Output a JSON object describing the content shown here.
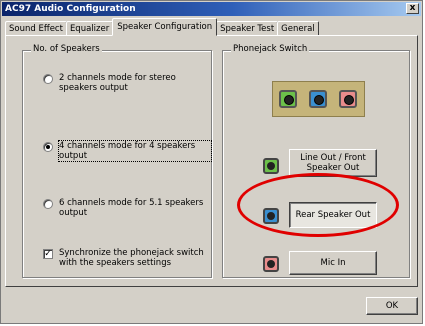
{
  "window": {
    "title": "AC97 Audio Configuration",
    "close_glyph": "x"
  },
  "tabs": [
    {
      "label": "Sound Effect",
      "active": false
    },
    {
      "label": "Equalizer",
      "active": false
    },
    {
      "label": "Speaker Configuration",
      "active": true
    },
    {
      "label": "Speaker Test",
      "active": false
    },
    {
      "label": "General",
      "active": false
    }
  ],
  "speakers_group": {
    "label": "No. of Speakers",
    "options": [
      {
        "label": "2 channels mode for stereo speakers output",
        "selected": false
      },
      {
        "label": "4 channels mode for 4 speakers output",
        "selected": true
      },
      {
        "label": "6 channels mode for 5.1 speakers output",
        "selected": false
      }
    ],
    "sync_checkbox": {
      "label": "Synchronize the phonejack switch with the speakers settings",
      "checked": true,
      "check_glyph": "✓"
    }
  },
  "phonejack_group": {
    "label": "Phonejack Switch",
    "jack_colors": [
      "#6cc04a",
      "#3a8fd0",
      "#e88c8c"
    ],
    "buttons": [
      {
        "label": "Line Out / Front Speaker Out",
        "color": "#6cc04a"
      },
      {
        "label": "Rear Speaker Out",
        "color": "#3a8fd0",
        "highlighted": true
      },
      {
        "label": "Mic In",
        "color": "#e88c8c"
      }
    ]
  },
  "footer": {
    "ok_label": "OK"
  }
}
